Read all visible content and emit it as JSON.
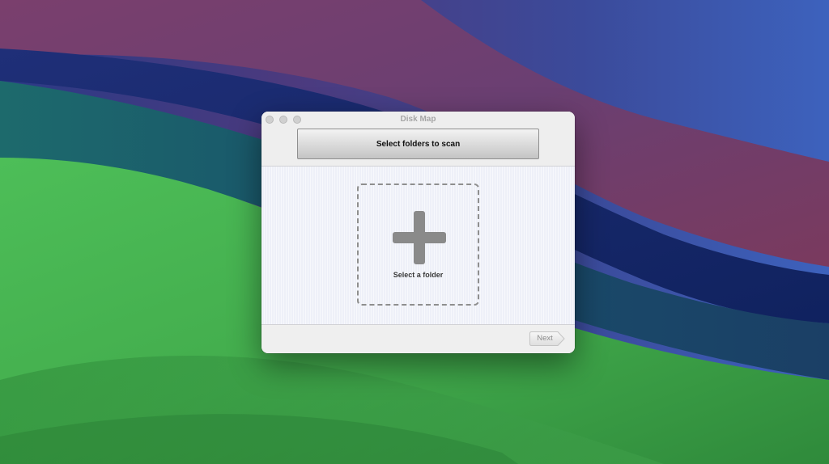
{
  "window": {
    "title": "Disk Map"
  },
  "toolbar": {
    "scan_button_label": "Select folders to scan"
  },
  "drop_zone": {
    "label": "Select a folder",
    "icon": "plus-icon"
  },
  "footer": {
    "next_label": "Next"
  },
  "colors": {
    "window_bg": "#f1f1f1",
    "content_bg": "#eef0f8",
    "plus_icon": "#8a8a8a",
    "dashed_border": "#8e8e8e",
    "title_text": "#a6a6a6"
  }
}
